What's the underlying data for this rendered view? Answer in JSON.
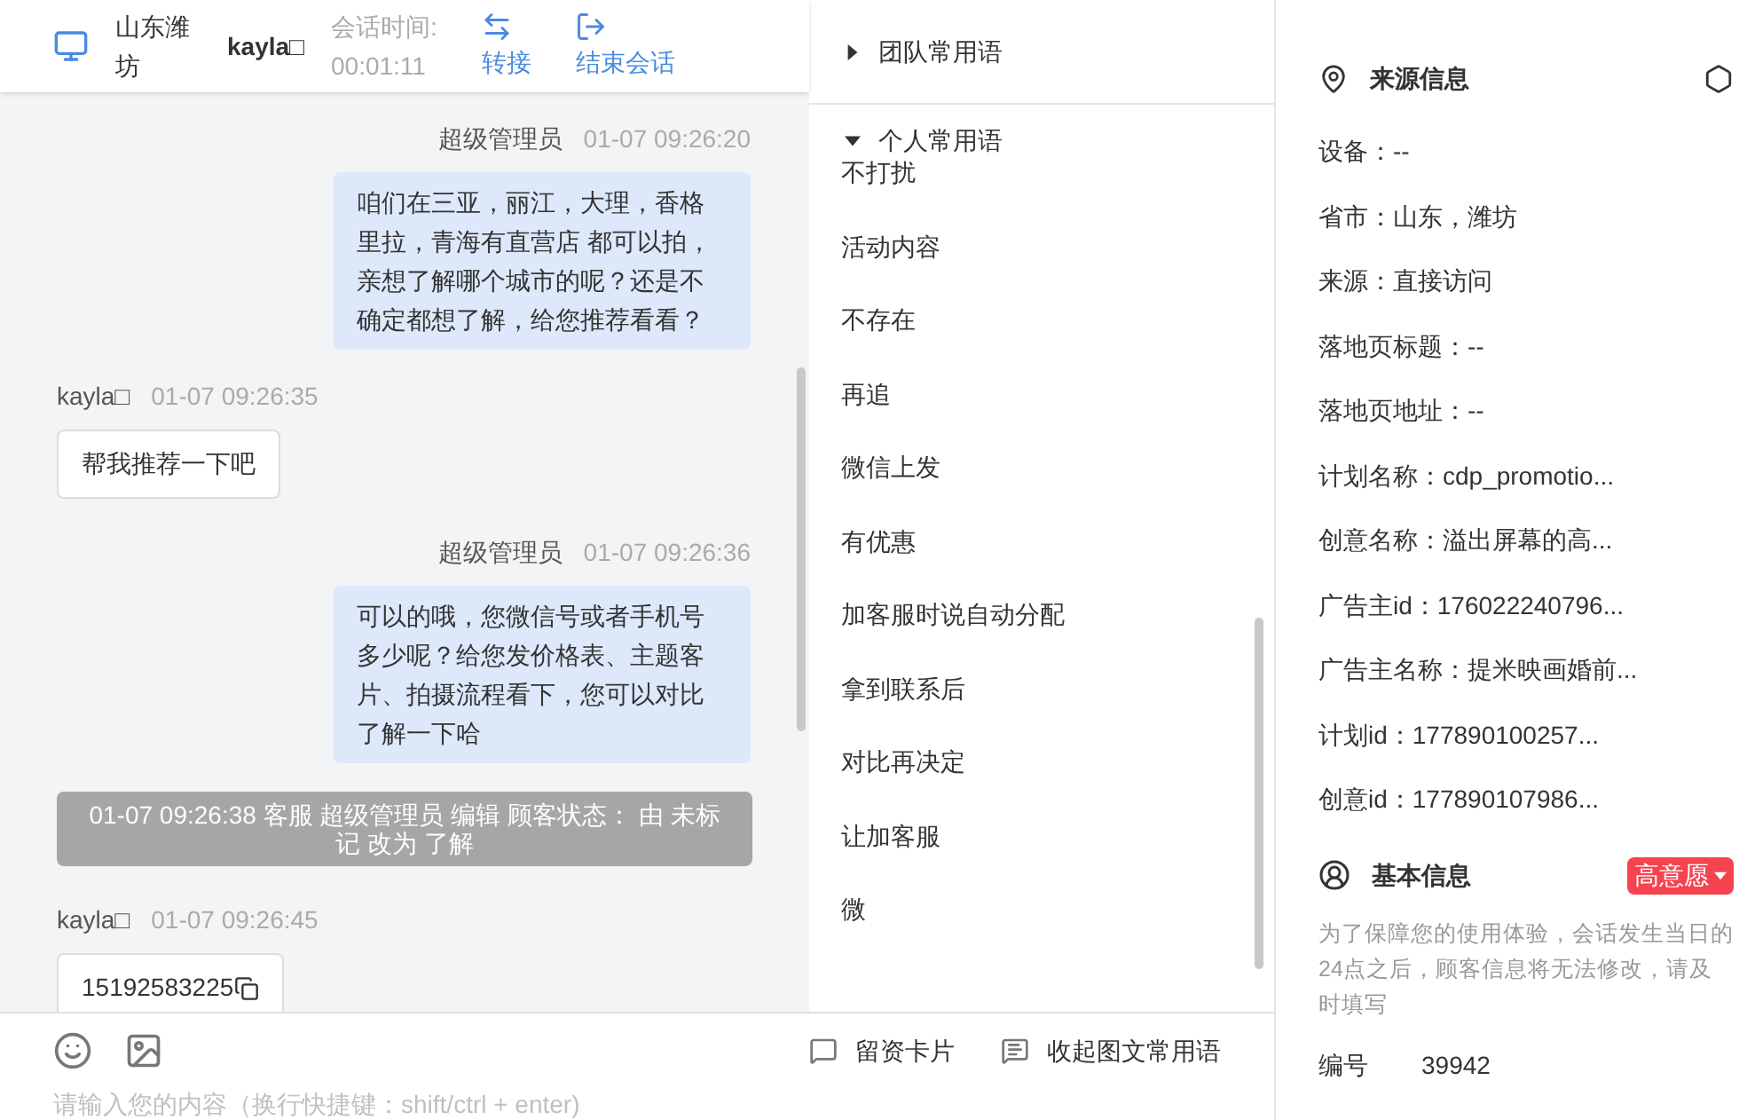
{
  "header": {
    "location": "山东潍坊",
    "customer": "kayla□",
    "duration_label": "会话时间:",
    "duration": "00:01:11",
    "actions": [
      {
        "kind": "transfer",
        "label": "转接"
      },
      {
        "kind": "end",
        "label": "结束会话"
      }
    ]
  },
  "messages": [
    {
      "kind": "agent",
      "sender": "超级管理员",
      "time": "01-07 09:26:20",
      "text": "咱们在三亚，丽江，大理，香格里拉，青海有直营店 都可以拍，亲想了解哪个城市的呢？还是不确定都想了解，给您推荐看看？"
    },
    {
      "kind": "customer",
      "sender": "kayla□",
      "time": "01-07 09:26:35",
      "text": "帮我推荐一下吧",
      "copyable": false
    },
    {
      "kind": "agent",
      "sender": "超级管理员",
      "time": "01-07 09:26:36",
      "text": "可以的哦，您微信号或者手机号多少呢？给您发价格表、主题客片、拍摄流程看下，您可以对比了解一下哈"
    },
    {
      "kind": "system",
      "text": "01-07 09:26:38 客服 超级管理员 编辑 顾客状态： 由 未标记 改为 了解"
    },
    {
      "kind": "customer",
      "sender": "kayla□",
      "time": "01-07 09:26:45",
      "text": "15192583225",
      "copyable": true
    }
  ],
  "composer": {
    "tools": [
      {
        "kind": "card",
        "label": "留资卡片"
      },
      {
        "kind": "phrases",
        "label": "收起图文常用语"
      }
    ],
    "placeholder": "请输入您的内容（换行快捷键：shift/ctrl + enter)"
  },
  "phrases": {
    "groups": [
      {
        "title": "团队常用语",
        "expanded": false
      },
      {
        "title": "个人常用语",
        "expanded": true,
        "items": [
          "不打扰",
          "活动内容",
          "不存在",
          "再追",
          "微信上发",
          "有优惠",
          "加客服时说自动分配",
          "拿到联系后",
          "对比再决定",
          "让加客服",
          "微"
        ]
      }
    ]
  },
  "source_info": {
    "title": "来源信息",
    "fields": [
      "设备：--",
      "省市：山东，潍坊",
      "来源：直接访问",
      "落地页标题：--",
      "落地页地址：--",
      "计划名称：cdp_promotio...",
      "创意名称：溢出屏幕的高...",
      "广告主id：176022240796...",
      "广告主名称：提米映画婚前...",
      "计划id：177890100257...",
      "创意id：177890107986..."
    ]
  },
  "basic_info": {
    "title": "基本信息",
    "intent": "高意愿",
    "note": "为了保障您的使用体验，会话发生当日的24点之后，顾客信息将无法修改，请及时填写",
    "fields": [
      {
        "label": "编号",
        "value": "39942"
      }
    ]
  }
}
